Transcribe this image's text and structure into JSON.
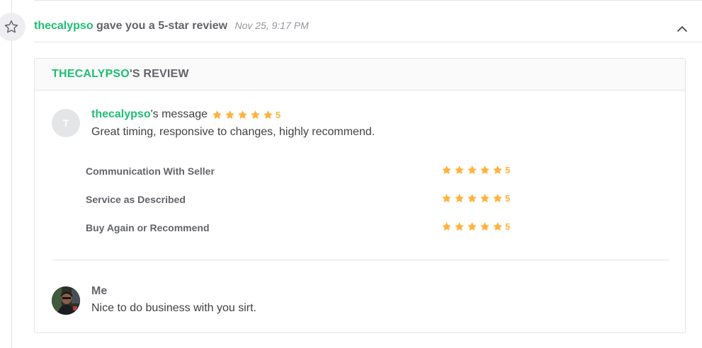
{
  "notification": {
    "username": "thecalypso",
    "action_text": "gave you a 5-star review",
    "timestamp": "Nov 25, 9:17 PM",
    "icon": "star-outline-icon",
    "toggle_icon": "chevron-up-icon"
  },
  "review": {
    "header_user": "THECALYPSO",
    "header_suffix": "'S REVIEW",
    "reviewer_initial": "T",
    "reviewer_name": "thecalypso",
    "message_suffix": "'s message",
    "overall_rating": 5,
    "overall_score": "5",
    "message": "Great timing, responsive to changes, highly recommend.",
    "ratings": [
      {
        "label": "Communication With Seller",
        "value": 5,
        "score": "5"
      },
      {
        "label": "Service as Described",
        "value": 5,
        "score": "5"
      },
      {
        "label": "Buy Again or Recommend",
        "value": 5,
        "score": "5"
      }
    ]
  },
  "reply": {
    "name": "Me",
    "message": "Nice to do business with you sirt."
  },
  "colors": {
    "brand_green": "#1dbf73",
    "star_gold": "#ffb33e",
    "border": "#e4e5e7",
    "text": "#404145",
    "muted": "#62646a"
  }
}
